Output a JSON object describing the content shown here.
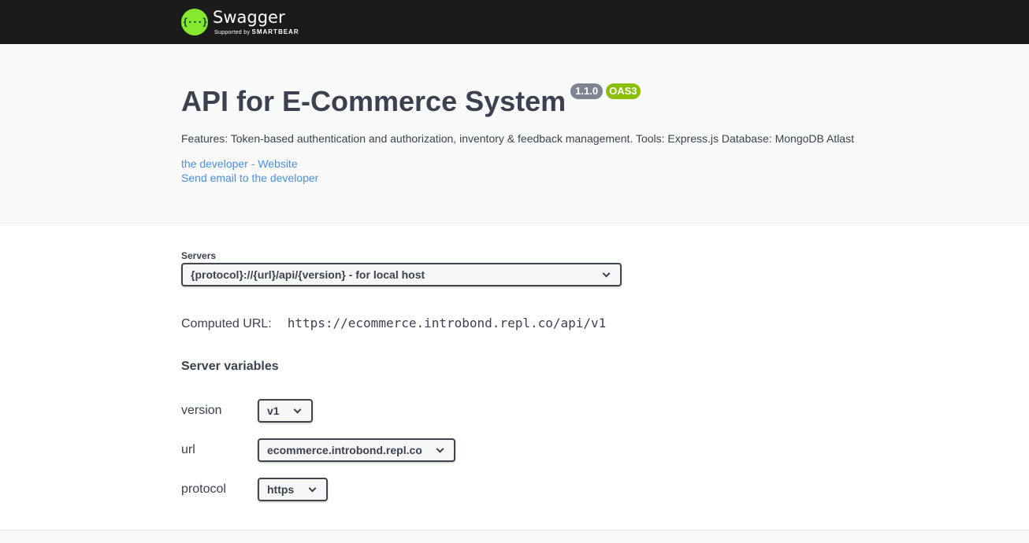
{
  "topbar": {
    "logo_glyph": "{···}",
    "logo_name": "Swagger",
    "logo_supported": "Supported by",
    "logo_brand": "SMARTBEAR"
  },
  "info": {
    "title": "API for E-Commerce System",
    "version_badge": "1.1.0",
    "oas_badge": "OAS3",
    "description": "Features: Token-based authentication and authorization, inventory & feedback management. Tools: Express.js Database: MongoDB Atlast",
    "link_website": "the developer - Website",
    "link_email": "Send email to the developer"
  },
  "servers": {
    "label": "Servers",
    "selected": "{protocol}://{url}/api/{version} - for local host",
    "computed_label": "Computed URL:",
    "computed_url": "https://ecommerce.introbond.repl.co/api/v1",
    "variables_title": "Server variables",
    "variables": [
      {
        "name": "version",
        "value": "v1"
      },
      {
        "name": "url",
        "value": "ecommerce.introbond.repl.co"
      },
      {
        "name": "protocol",
        "value": "https"
      }
    ]
  },
  "colors": {
    "topbar_bg": "#1b1b1b",
    "logo_green": "#85ea2d",
    "version_badge": "#7d8492",
    "oas_badge": "#89bf04",
    "link": "#4990e2"
  }
}
